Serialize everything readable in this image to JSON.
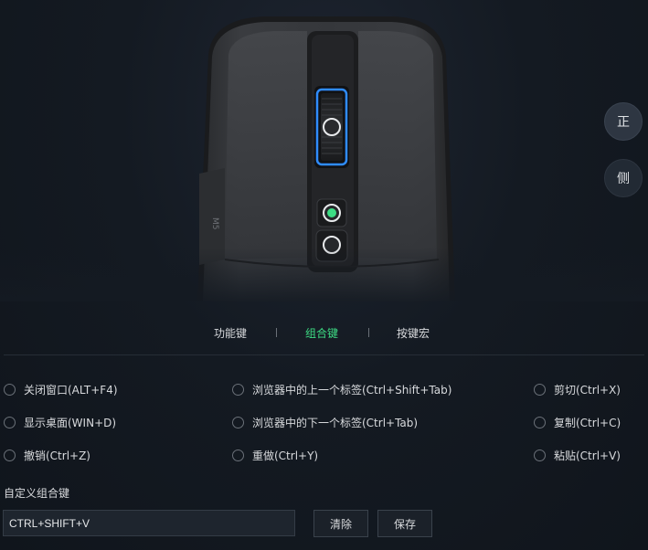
{
  "mouse": {
    "model_mark": "M5"
  },
  "view_buttons": {
    "front": "正",
    "side": "侧"
  },
  "tabs": [
    {
      "label": "功能键",
      "active": false
    },
    {
      "label": "组合键",
      "active": true
    },
    {
      "label": "按键宏",
      "active": false
    }
  ],
  "options": {
    "col1": [
      "关闭窗口(ALT+F4)",
      "显示桌面(WIN+D)",
      "撤销(Ctrl+Z)"
    ],
    "col2": [
      "浏览器中的上一个标签(Ctrl+Shift+Tab)",
      "浏览器中的下一个标签(Ctrl+Tab)",
      "重做(Ctrl+Y)"
    ],
    "col3": [
      "剪切(Ctrl+X)",
      "复制(Ctrl+C)",
      "粘贴(Ctrl+V)"
    ]
  },
  "custom": {
    "label": "自定义组合键",
    "value": "CTRL+SHIFT+V",
    "clear_label": "清除",
    "save_label": "保存"
  },
  "colors": {
    "accent": "#3ddc84",
    "scroll_glow": "#2f8cff",
    "background": "#141a22"
  }
}
